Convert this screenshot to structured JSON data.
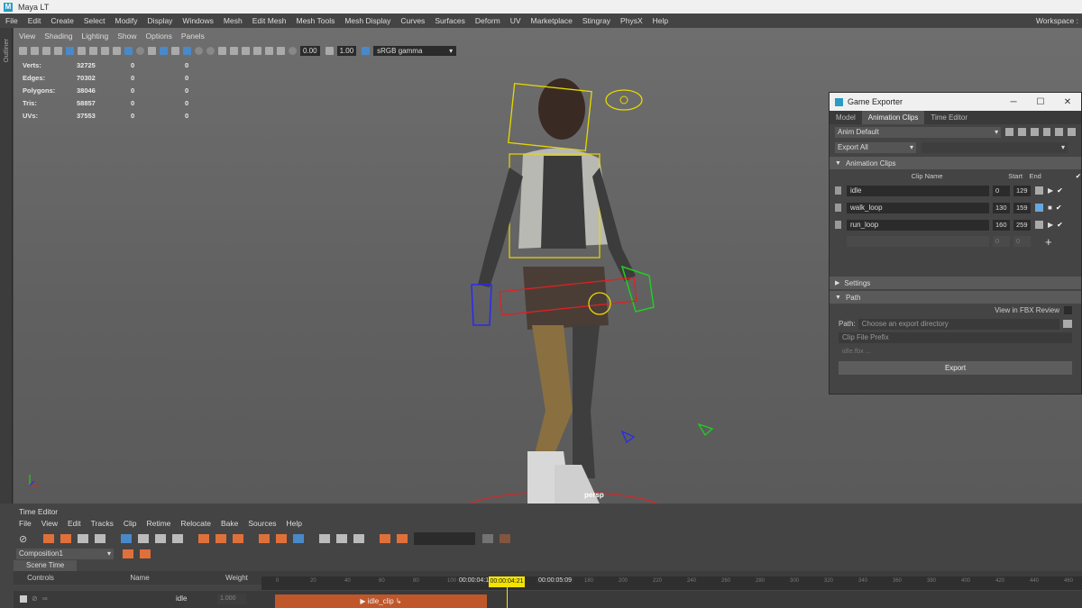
{
  "app": {
    "title": "Maya LT",
    "workspace": "Workspace :"
  },
  "main_menu": [
    "File",
    "Edit",
    "Create",
    "Select",
    "Modify",
    "Display",
    "Windows",
    "Mesh",
    "Edit Mesh",
    "Mesh Tools",
    "Mesh Display",
    "Curves",
    "Surfaces",
    "Deform",
    "UV",
    "Marketplace",
    "Stingray",
    "PhysX",
    "Help"
  ],
  "outliner_label": "Outliner",
  "panel_menu": [
    "View",
    "Shading",
    "Lighting",
    "Show",
    "Options",
    "Panels"
  ],
  "viewport_toolbar": {
    "exposure": "0.00",
    "gamma": "1.00",
    "color_space": "sRGB gamma"
  },
  "hud": [
    {
      "label": "Verts:",
      "v1": "32725",
      "v2": "0",
      "v3": "0"
    },
    {
      "label": "Edges:",
      "v1": "70302",
      "v2": "0",
      "v3": "0"
    },
    {
      "label": "Polygons:",
      "v1": "38046",
      "v2": "0",
      "v3": "0"
    },
    {
      "label": "Tris:",
      "v1": "58857",
      "v2": "0",
      "v3": "0"
    },
    {
      "label": "UVs:",
      "v1": "37553",
      "v2": "0",
      "v3": "0"
    }
  ],
  "camera_label": "persp",
  "game_exporter": {
    "title": "Game Exporter",
    "tabs": [
      "Model",
      "Animation Clips",
      "Time Editor"
    ],
    "preset": "Anim Default",
    "export_mode": "Export All",
    "section_clips": "Animation Clips",
    "col_clip_name": "Clip Name",
    "col_start": "Start",
    "col_end": "End",
    "clips": [
      {
        "name": "idle",
        "start": "0",
        "end": "129"
      },
      {
        "name": "walk_loop",
        "start": "130",
        "end": "159"
      },
      {
        "name": "run_loop",
        "start": "160",
        "end": "259"
      }
    ],
    "empty_start": "0",
    "empty_end": "0",
    "section_settings": "Settings",
    "section_path": "Path",
    "view_fbx": "View in FBX Review",
    "path_label": "Path:",
    "path_placeholder": "Choose an export directory",
    "prefix_placeholder": "Clip File Prefix",
    "file_hint": "idle.fbx ...",
    "export_label": "Export"
  },
  "time_editor": {
    "title": "Time Editor",
    "menu": [
      "File",
      "View",
      "Edit",
      "Tracks",
      "Clip",
      "Retime",
      "Relocate",
      "Bake",
      "Sources",
      "Help"
    ],
    "composition": "Composition1",
    "scene_time": "Scene Time",
    "col_controls": "Controls",
    "col_name": "Name",
    "col_weight": "Weight",
    "track_name": "idle",
    "track_weight": "1.000",
    "ruler_ticks": [
      "0",
      "20",
      "40",
      "60",
      "80",
      "100",
      "120",
      "140",
      "160",
      "180",
      "200",
      "220",
      "240",
      "260",
      "280",
      "300",
      "320",
      "340",
      "360",
      "380",
      "400",
      "420",
      "440",
      "460"
    ],
    "marker_start": "00:00:04:10",
    "marker_current": "00:00:04:21",
    "marker_end": "00:00:05:09",
    "clip_label": "idle_clip"
  }
}
